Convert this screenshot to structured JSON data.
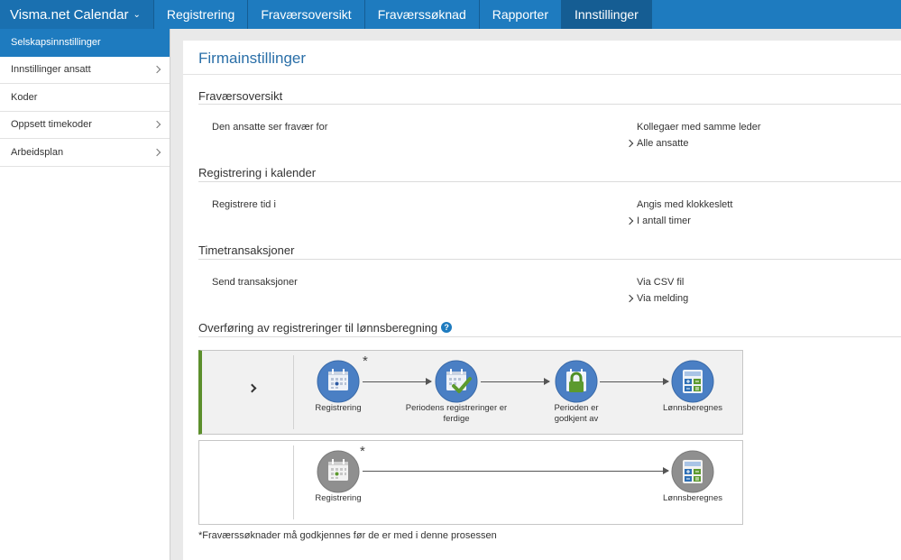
{
  "topnav": {
    "brand": "Visma.net Calendar",
    "tabs": [
      "Registrering",
      "Fraværsoversikt",
      "Fraværssøknad",
      "Rapporter",
      "Innstillinger"
    ]
  },
  "sidebar": {
    "items": [
      {
        "label": "Selskapsinnstillinger"
      },
      {
        "label": "Innstillinger ansatt"
      },
      {
        "label": "Koder"
      },
      {
        "label": "Oppsett timekoder"
      },
      {
        "label": "Arbeidsplan"
      }
    ]
  },
  "main": {
    "title": "Firmainstillinger",
    "sections": [
      {
        "heading": "Fraværsoversikt",
        "label": "Den ansatte ser fravær for",
        "options": [
          "Kollegaer med samme leder",
          "Alle ansatte"
        ]
      },
      {
        "heading": "Registrering i kalender",
        "label": "Registrere tid i",
        "options": [
          "Angis med klokkeslett",
          "I antall timer"
        ]
      },
      {
        "heading": "Timetransaksjoner",
        "label": "Send transaksjoner",
        "options": [
          "Via CSV fil",
          "Via melding"
        ]
      }
    ],
    "transfer": {
      "heading": "Overføring av registreringer til lønnsberegning",
      "help": "?",
      "flow1": {
        "asterisk": "*",
        "steps": [
          "Registrering",
          "Periodens registreringer er ferdige",
          "Perioden er godkjent av",
          "Lønnsberegnes"
        ]
      },
      "flow2": {
        "asterisk": "*",
        "steps": [
          "Registrering",
          "Lønnsberegnes"
        ]
      },
      "footnote": "*Fraværssøknader må godkjennes før de er med i denne prosessen"
    }
  },
  "colors": {
    "nav": "#1e7bbf",
    "active_tab": "#155d93",
    "step_blue": "#4a7fc4",
    "step_grey": "#8f8f8f",
    "green": "#5c8f2c"
  }
}
